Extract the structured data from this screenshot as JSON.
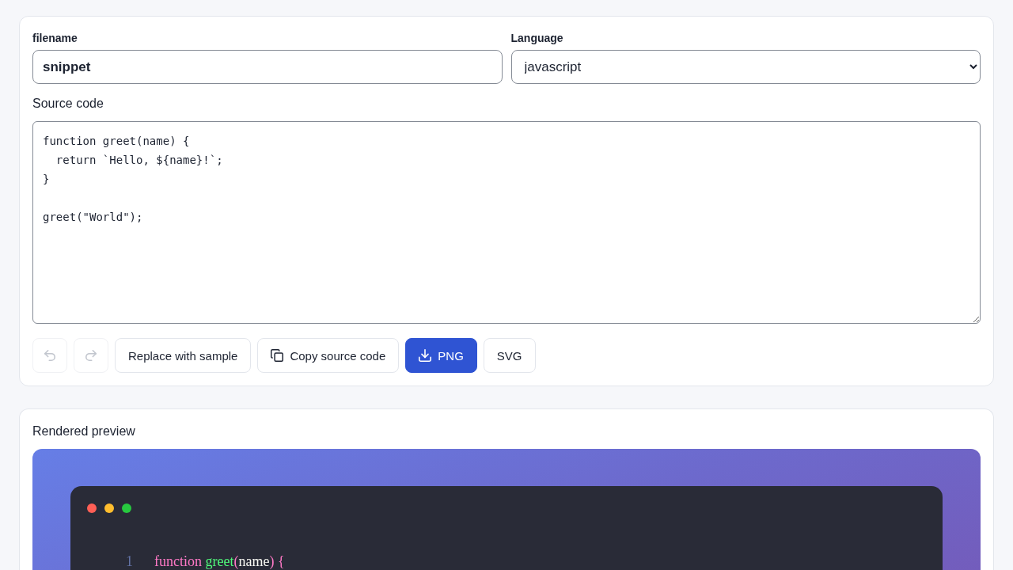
{
  "editor": {
    "filename": {
      "label": "filename",
      "value": "snippet"
    },
    "language": {
      "label": "Language",
      "value": "javascript"
    },
    "source": {
      "label": "Source code",
      "value": "function greet(name) {\n  return `Hello, ${name}!`;\n}\n\ngreet(\"World\");"
    }
  },
  "toolbar": [
    {
      "kind": "undo",
      "disabled": true,
      "primary": false
    },
    {
      "kind": "redo",
      "disabled": true,
      "primary": false
    },
    {
      "kind": "text",
      "label": "Replace with sample",
      "disabled": false,
      "primary": false
    },
    {
      "kind": "copy",
      "label": "Copy source code",
      "disabled": false,
      "primary": false
    },
    {
      "kind": "download",
      "label": "PNG",
      "disabled": false,
      "primary": true
    },
    {
      "kind": "text",
      "label": "SVG",
      "disabled": false,
      "primary": false
    }
  ],
  "preview": {
    "title": "Rendered preview",
    "window_dots": [
      {
        "color": "#ff5f56"
      },
      {
        "color": "#ffbd2e"
      },
      {
        "color": "#27c93f"
      }
    ],
    "code_lines": [
      {
        "number": "1",
        "tokens": [
          {
            "text": "function ",
            "kind": "keyword"
          },
          {
            "text": "greet",
            "kind": "function"
          },
          {
            "text": "(",
            "kind": "punctuation"
          },
          {
            "text": "name",
            "kind": "variable"
          },
          {
            "text": ") {",
            "kind": "punctuation"
          }
        ]
      }
    ]
  }
}
